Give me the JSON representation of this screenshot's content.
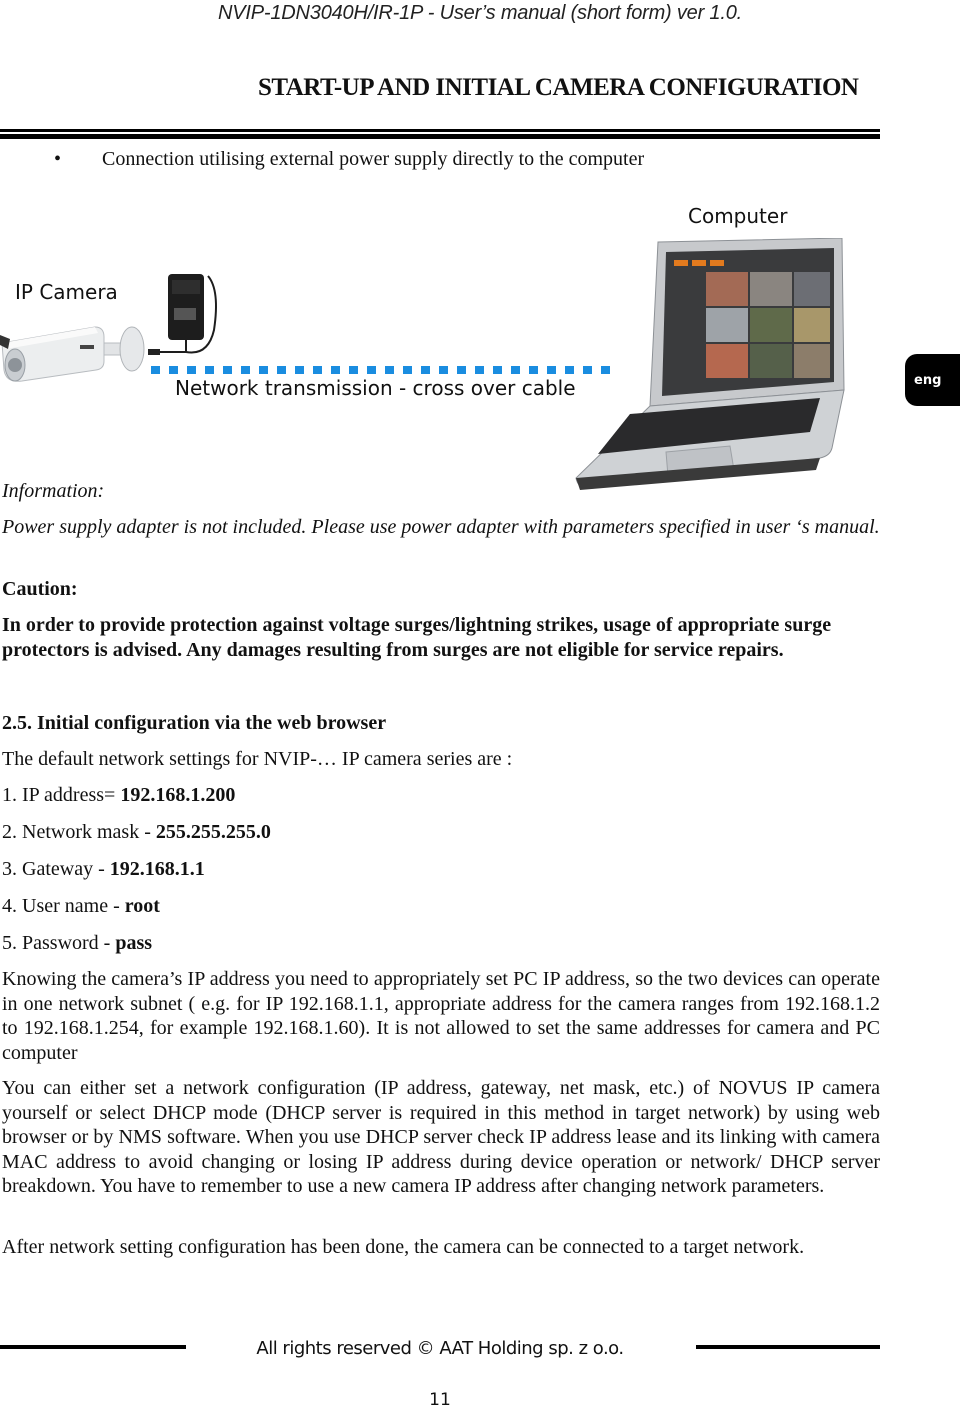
{
  "header": {
    "running_title": "NVIP-1DN3040H/IR-1P - User’s manual (short form) ver 1.0.",
    "section_title": "START-UP AND INITIAL CAMERA CONFIGURATION"
  },
  "bullet": {
    "symbol": "•",
    "text": "Connection utilising external power supply directly to the computer"
  },
  "diagram": {
    "computer_label": "Computer",
    "camera_label": "IP Camera",
    "network_label": "Network transmission - cross over cable",
    "cable_color": "#1a8de0"
  },
  "side_tab": {
    "label": "eng"
  },
  "information": {
    "heading": "Information:",
    "text": "Power supply adapter is not included. Please use power adapter with parameters specified in user ‘s manual."
  },
  "caution": {
    "heading": "Caution:",
    "text": "In order to provide protection against voltage surges/lightning strikes, usage of appropriate surge protectors is advised. Any damages resulting from surges are not eligible for service repairs."
  },
  "section_2_5": {
    "heading": "2.5. Initial configuration via the web browser",
    "intro": "The default network settings for NVIP-… IP camera series are :",
    "settings": [
      {
        "label": "1. IP address= ",
        "value": "192.168.1.200"
      },
      {
        "label": "2. Network mask - ",
        "value": "255.255.255.0"
      },
      {
        "label": "3. Gateway - ",
        "value": "192.168.1.1"
      },
      {
        "label": "4. User name - ",
        "value": "root"
      },
      {
        "label": "5. Password - ",
        "value": "pass"
      }
    ],
    "paragraphs": [
      "Knowing the camera’s IP address you need to appropriately set PC IP address, so the two devices can operate in one network subnet ( e.g. for IP 192.168.1.1, appropriate address for the camera ranges from 192.168.1.2 to 192.168.1.254, for example 192.168.1.60). It is not allowed to set the same addresses for camera and PC computer",
      "You can either set a network configuration (IP address, gateway, net mask, etc.) of NOVUS IP camera yourself or select DHCP mode (DHCP server is required in this method in target network) by using web browser or by NMS software. When you use DHCP server check IP address lease and its linking with camera MAC address to avoid changing or losing IP address during device operation or network/ DHCP server breakdown. You have to remember to use a new camera IP address after changing network parameters.",
      "After network setting configuration has been done, the camera can be connected to a target network."
    ]
  },
  "footer": {
    "copyright": "All rights reserved © AAT Holding sp. z o.o.",
    "page_number": "11"
  }
}
